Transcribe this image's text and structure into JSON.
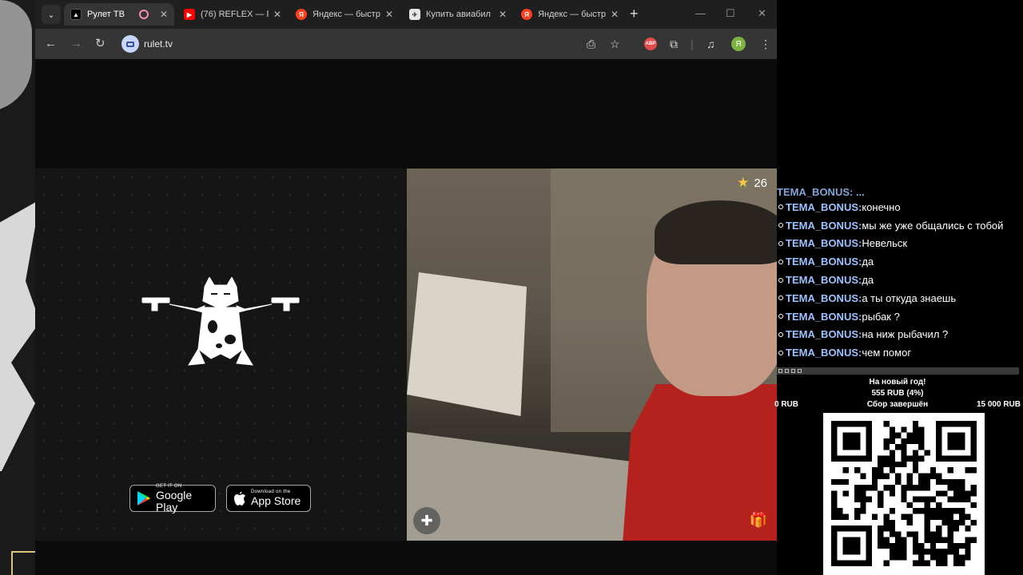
{
  "browser": {
    "tabs": [
      {
        "title": "Рулет ТВ",
        "active": true,
        "recording": true
      },
      {
        "title": "(76) REFLEX — П",
        "active": false
      },
      {
        "title": "Яндекс — быстр",
        "active": false
      },
      {
        "title": "Купить авиабил",
        "active": false
      },
      {
        "title": "Яндекс — быстр",
        "active": false
      }
    ],
    "url": "rulet.tv",
    "extension_badge": "ABP",
    "profile_letter": "Я"
  },
  "promo": {
    "google_play": {
      "small": "GET IT ON",
      "big": "Google Play"
    },
    "app_store": {
      "small": "Download on the",
      "big": "App Store"
    }
  },
  "video": {
    "stars": "26"
  },
  "chat": {
    "partial_line": "TEMA_BONUS: ...",
    "messages": [
      {
        "nick": "TEMA_BONUS:",
        "text": "конечно"
      },
      {
        "nick": "TEMA_BONUS:",
        "text": "мы же уже общались с тобой"
      },
      {
        "nick": "TEMA_BONUS:",
        "text": "Невельск"
      },
      {
        "nick": "TEMA_BONUS:",
        "text": "да"
      },
      {
        "nick": "TEMA_BONUS:",
        "text": "да"
      },
      {
        "nick": "TEMA_BONUS:",
        "text": "а ты откуда знаешь"
      },
      {
        "nick": "TEMA_BONUS:",
        "text": "рыбак ?"
      },
      {
        "nick": "TEMA_BONUS:",
        "text": "на ниж рыбачил ?"
      },
      {
        "nick": "TEMA_BONUS:",
        "text": "чем помог"
      }
    ]
  },
  "goal": {
    "title": "На новый год!",
    "collected": "555 RUB (4%)",
    "min": "0 RUB",
    "status": "Сбор завершён",
    "max": "15 000 RUB"
  },
  "colors": {
    "nick": "#9cc1ff",
    "tab_active": "#353535",
    "star": "#f6c744"
  }
}
